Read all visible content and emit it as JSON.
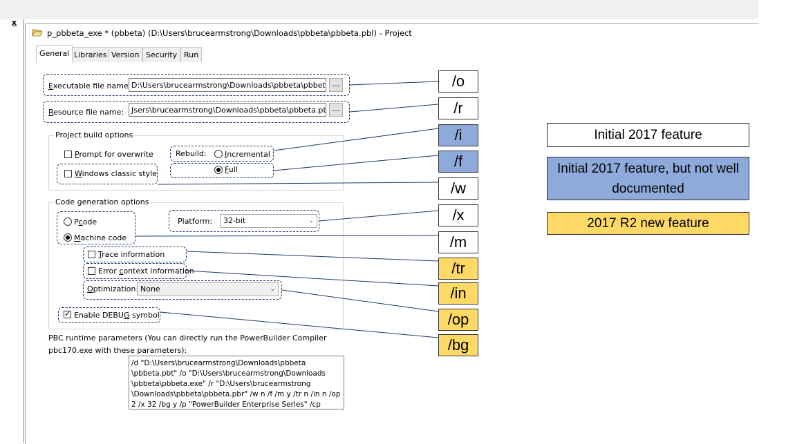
{
  "window": {
    "close_glyph": "x",
    "title": "p_pbbeta_exe * (pbbeta) (D:\\Users\\brucearmstrong\\Downloads\\pbbeta\\pbbeta.pbl) - Project",
    "folder_icon": "folder-open-icon"
  },
  "tabs": [
    {
      "label": "General",
      "active": true
    },
    {
      "label": "Libraries",
      "active": false
    },
    {
      "label": "Version",
      "active": false
    },
    {
      "label": "Security",
      "active": false
    },
    {
      "label": "Run",
      "active": false
    }
  ],
  "executable": {
    "label_pre": "",
    "label_u": "E",
    "label_post": "xecutable file name:",
    "value": "D:\\Users\\brucearmstrong\\Downloads\\pbbeta\\pbbeta.exe",
    "browse_label": "..."
  },
  "resource": {
    "label_pre": "",
    "label_u": "R",
    "label_post": "esource file name:",
    "value": "Jsers\\brucearmstrong\\Downloads\\pbbeta\\pbbeta.pbr",
    "browse_label": "..."
  },
  "build_options": {
    "group_title": "Project build options",
    "prompt_overwrite": {
      "pre": "",
      "u": "P",
      "post": "rompt for overwrite",
      "checked": false
    },
    "windows_classic": {
      "pre": "",
      "u": "W",
      "post": "indows classic style",
      "checked": false
    },
    "rebuild_label": "Rebuild:",
    "incremental": {
      "pre": "",
      "u": "I",
      "post": "ncremental",
      "checked": false
    },
    "full": {
      "pre": "",
      "u": "F",
      "post": "ull",
      "checked": true
    }
  },
  "code_gen": {
    "group_title": "Code generation options",
    "pcode": {
      "pre": "P",
      "u": "c",
      "post": "ode",
      "checked": false
    },
    "machine_code": {
      "pre": "",
      "u": "M",
      "post": "achine code",
      "checked": true
    },
    "platform_label": "Platform:",
    "platform_value": "32-bit",
    "trace": {
      "pre": "",
      "u": "T",
      "post": "race information",
      "checked": false
    },
    "error_context": {
      "pre": "Error ",
      "u": "c",
      "post": "ontext information",
      "checked": false
    },
    "optimization_label_pre": "",
    "optimization_label_u": "O",
    "optimization_label_post": "ptimization:",
    "optimization_value": "None",
    "debug": {
      "pre": "Enable DEBU",
      "u": "G",
      "post": " symbol",
      "checked": true
    }
  },
  "runtime": {
    "line1": "PBC runtime parameters (You can directly run the PowerBuilder Compiler",
    "line2": "pbc170.exe with these parameters):",
    "params": "/d \"D:\\Users\\brucearmstrong\\Downloads\\pbbeta\n\\pbbeta.pbt\" /o \"D:\\Users\\brucearmstrong\\Downloads\n\\pbbeta\\pbbeta.exe\" /r \"D:\\Users\\brucearmstrong\n\\Downloads\\pbbeta\\pbbeta.pbr\" /w n /f /m y /tr n /in n /op\n2 /x 32 /bg y /p \"PowerBuilder Enterprise Series\" /cp"
  },
  "switches": [
    {
      "text": "/o",
      "kind": "initial"
    },
    {
      "text": "/r",
      "kind": "initial"
    },
    {
      "text": "/i",
      "kind": "undocumented"
    },
    {
      "text": "/f",
      "kind": "undocumented"
    },
    {
      "text": "/w",
      "kind": "initial"
    },
    {
      "text": "/x",
      "kind": "initial"
    },
    {
      "text": "/m",
      "kind": "initial"
    },
    {
      "text": "/tr",
      "kind": "r2"
    },
    {
      "text": "/in",
      "kind": "r2"
    },
    {
      "text": "/op",
      "kind": "r2"
    },
    {
      "text": "/bg",
      "kind": "r2"
    }
  ],
  "legend": [
    {
      "label": "Initial 2017 feature",
      "kind": "initial"
    },
    {
      "label": "Initial 2017 feature, but not well documented",
      "kind": "undocumented"
    },
    {
      "label": "2017 R2 new feature",
      "kind": "r2"
    }
  ],
  "colors": {
    "initial": "#ffffff",
    "undocumented": "#8eaadb",
    "r2": "#ffd966",
    "connector": "#1f3864"
  }
}
